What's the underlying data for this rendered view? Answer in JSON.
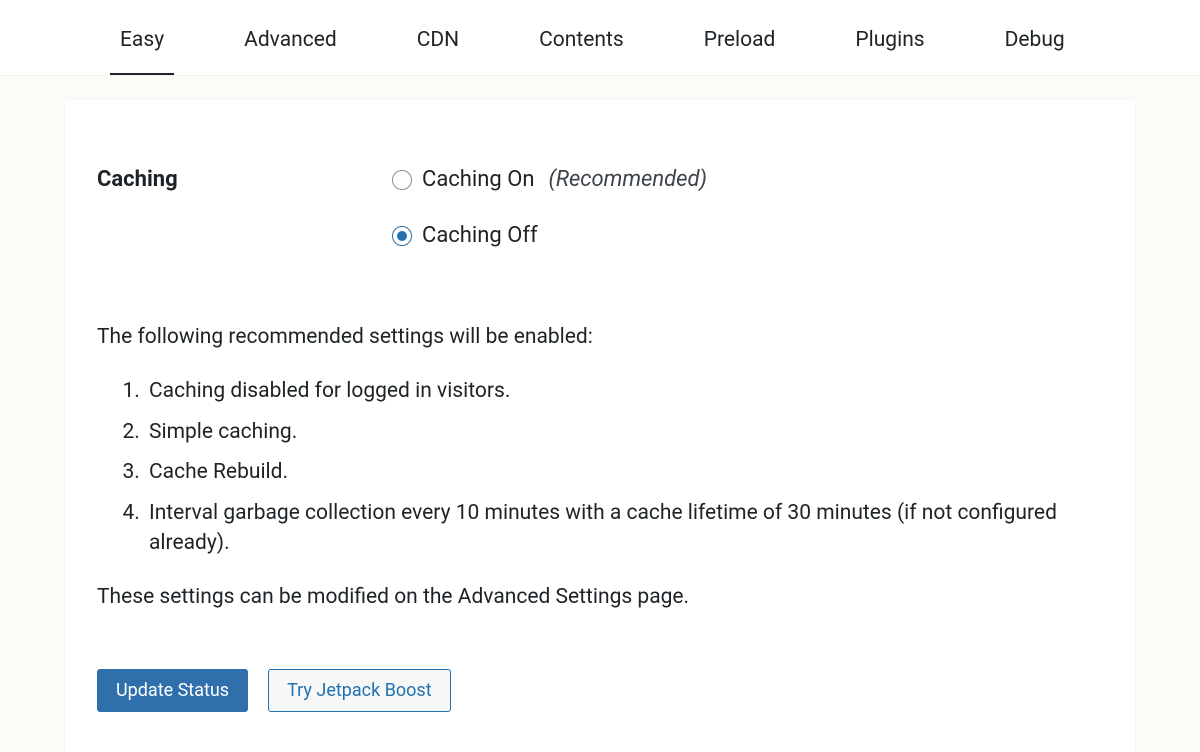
{
  "tabs": [
    {
      "label": "Easy",
      "active": true
    },
    {
      "label": "Advanced",
      "active": false
    },
    {
      "label": "CDN",
      "active": false
    },
    {
      "label": "Contents",
      "active": false
    },
    {
      "label": "Preload",
      "active": false
    },
    {
      "label": "Plugins",
      "active": false
    },
    {
      "label": "Debug",
      "active": false
    }
  ],
  "section": {
    "title": "Caching",
    "options": {
      "on": {
        "label": "Caching On",
        "note": "(Recommended)",
        "checked": false
      },
      "off": {
        "label": "Caching Off",
        "checked": true
      }
    }
  },
  "info": {
    "intro": "The following recommended settings will be enabled:",
    "items": [
      "Caching disabled for logged in visitors.",
      "Simple caching.",
      "Cache Rebuild.",
      "Interval garbage collection every 10 minutes with a cache lifetime of 30 minutes (if not configured already)."
    ],
    "outro": "These settings can be modified on the Advanced Settings page."
  },
  "buttons": {
    "primary": "Update Status",
    "secondary": "Try Jetpack Boost"
  }
}
